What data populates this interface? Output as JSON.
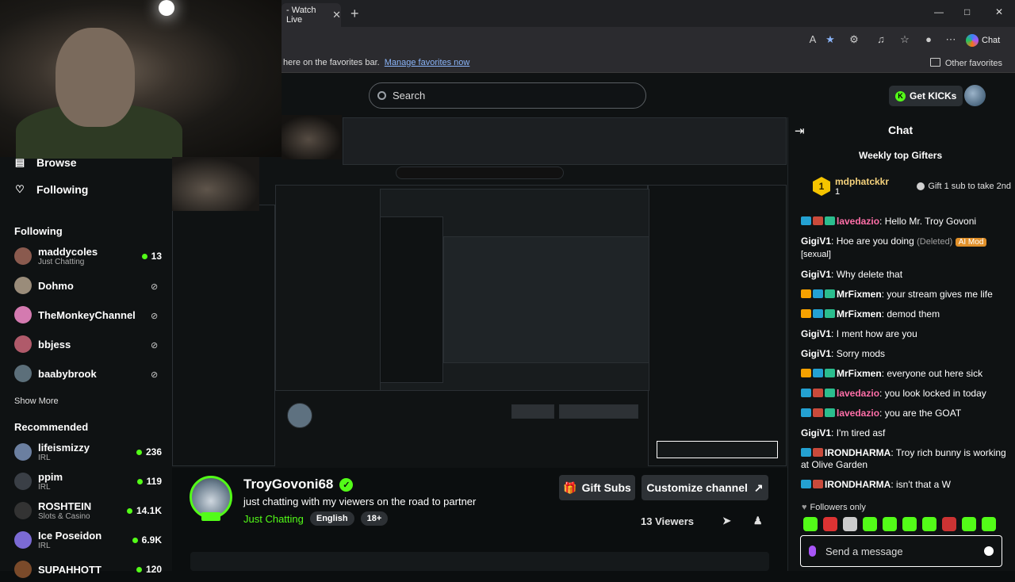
{
  "browser": {
    "tab_title": "- Watch Live",
    "tab_close": "✕",
    "new_tab": "+",
    "chat_button": "Chat",
    "favorites_text": "here on the favorites bar.",
    "favorites_link": "Manage favorites now",
    "other_favorites": "Other favorites"
  },
  "header": {
    "search_placeholder": "Search",
    "get_kicks": "Get KICKs"
  },
  "sidebar": {
    "browse": "Browse",
    "following_nav": "Following",
    "following_head": "Following",
    "following": [
      {
        "name": "maddycoles",
        "sub": "Just Chatting",
        "viewers": "13",
        "color": "#8a5a4e"
      },
      {
        "name": "Dohmo",
        "sub": "",
        "viewers": "",
        "color": "#9a8c7a"
      },
      {
        "name": "TheMonkeyChannel",
        "sub": "",
        "viewers": "",
        "color": "#d47ab0"
      },
      {
        "name": "bbjess",
        "sub": "",
        "viewers": "",
        "color": "#b05a6a"
      },
      {
        "name": "baabybrook",
        "sub": "",
        "viewers": "",
        "color": "#5c6f7a"
      }
    ],
    "show_more_1": "Show More",
    "recommended_head": "Recommended",
    "recommended": [
      {
        "name": "lifeismizzy",
        "sub": "IRL",
        "viewers": "236",
        "color": "#6b7fa0"
      },
      {
        "name": "ppim",
        "sub": "IRL",
        "viewers": "119",
        "color": "#3a3f46"
      },
      {
        "name": "ROSHTEIN",
        "sub": "Slots & Casino",
        "viewers": "14.1K",
        "color": "#333"
      },
      {
        "name": "Ice Poseidon",
        "sub": "IRL",
        "viewers": "6.9K",
        "color": "#7b6ad4"
      },
      {
        "name": "SUPAHHOTT",
        "sub": "",
        "viewers": "120",
        "color": "#7a4a2a"
      }
    ]
  },
  "stream": {
    "name": "TroyGovoni68",
    "title": "just chatting with my viewers on the road to partner",
    "category": "Just Chatting",
    "tags": [
      "English",
      "18+"
    ],
    "gift_subs": "Gift Subs",
    "customize": "Customize channel",
    "viewers": "13 Viewers",
    "live_badge": "LIVE"
  },
  "chat": {
    "title": "Chat",
    "weekly_top": "Weekly top Gifters",
    "top_gifter": {
      "rank": "1",
      "name": "mdphatckkr",
      "count": "1",
      "hint": "Gift 1 sub to take 2nd"
    },
    "messages": [
      {
        "user": "lavedazio",
        "color": "#ff6fa8",
        "text": "Hello Mr. Troy Govoni",
        "badges": [
          "bd-sub",
          "bd-red",
          "bd-grn"
        ]
      },
      {
        "user": "GigiV1",
        "color": "#ffffff",
        "text": "Hoe are you doing",
        "deleted": "(Deleted)",
        "mod": "AI Mod",
        "tag": "[sexual]",
        "badges": []
      },
      {
        "user": "GigiV1",
        "color": "#ffffff",
        "text": "Why delete that",
        "badges": []
      },
      {
        "user": "MrFixmen",
        "color": "#ffffff",
        "text": "your stream gives me life",
        "badges": [
          "bd-og",
          "bd-sub",
          "bd-grn"
        ]
      },
      {
        "user": "MrFixmen",
        "color": "#ffffff",
        "text": "demod them",
        "badges": [
          "bd-og",
          "bd-sub",
          "bd-grn"
        ]
      },
      {
        "user": "GigiV1",
        "color": "#ffffff",
        "text": "I ment how are you",
        "badges": []
      },
      {
        "user": "GigiV1",
        "color": "#ffffff",
        "text": "Sorry mods",
        "badges": []
      },
      {
        "user": "MrFixmen",
        "color": "#ffffff",
        "text": "everyone out here sick",
        "badges": [
          "bd-og",
          "bd-sub",
          "bd-grn"
        ]
      },
      {
        "user": "lavedazio",
        "color": "#ff6fa8",
        "text": "you look locked in today",
        "badges": [
          "bd-sub",
          "bd-red",
          "bd-grn"
        ]
      },
      {
        "user": "lavedazio",
        "color": "#ff6fa8",
        "text": "you are the GOAT",
        "badges": [
          "bd-sub",
          "bd-red",
          "bd-grn"
        ]
      },
      {
        "user": "GigiV1",
        "color": "#ffffff",
        "text": "I'm tired asf",
        "badges": []
      },
      {
        "user": "IRONDHARMA",
        "color": "#ffffff",
        "text": "Troy rich bunny is working at Olive Garden",
        "badges": [
          "bd-sub",
          "bd-red"
        ]
      },
      {
        "user": "IRONDHARMA",
        "color": "#ffffff",
        "text": "isn't that a W",
        "badges": [
          "bd-sub",
          "bd-red"
        ]
      }
    ],
    "followers_only": "Followers only",
    "send_placeholder": "Send a message"
  }
}
